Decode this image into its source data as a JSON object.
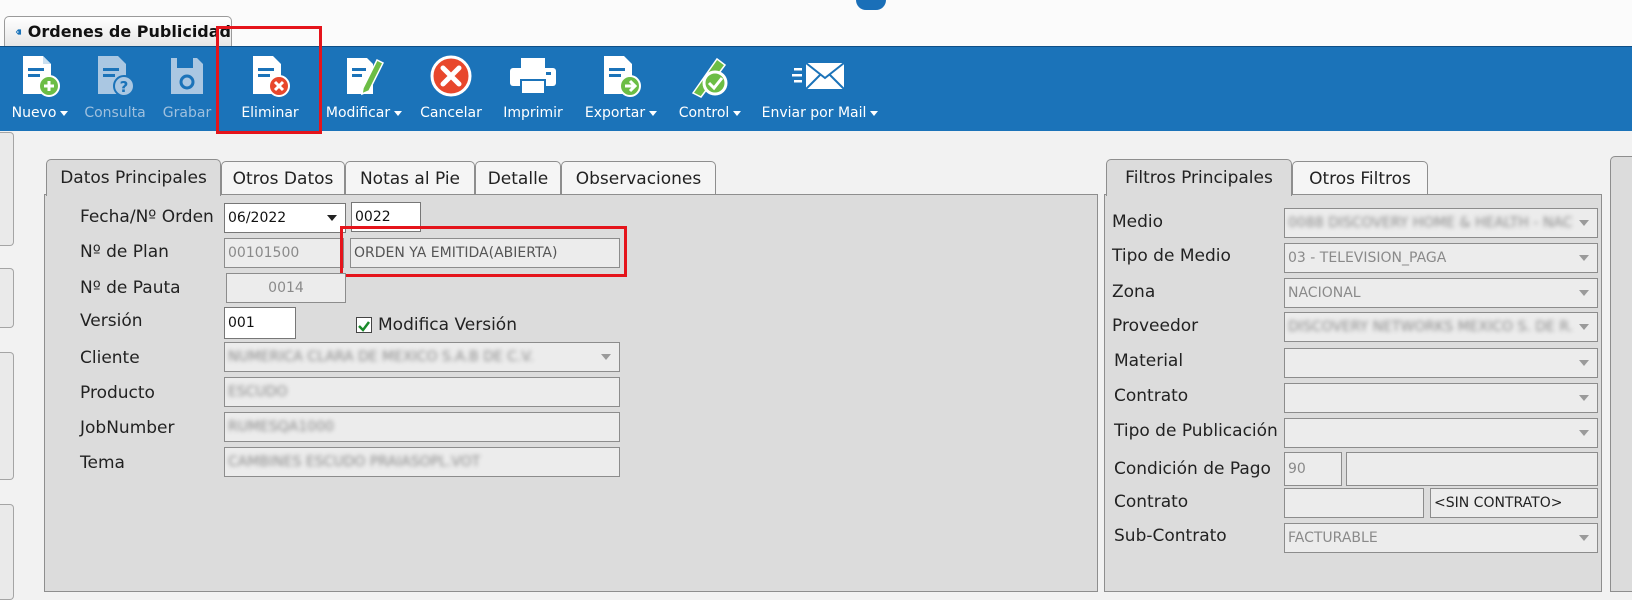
{
  "window": {
    "tab_title": "Ordenes de Publicidad"
  },
  "toolbar": {
    "nuevo": "Nuevo",
    "consulta": "Consulta",
    "grabar": "Grabar",
    "eliminar": "Eliminar",
    "modificar": "Modificar",
    "cancelar": "Cancelar",
    "imprimir": "Imprimir",
    "exportar": "Exportar",
    "control": "Control",
    "enviar_mail": "Enviar por Mail"
  },
  "main_tabs": [
    "Datos Principales",
    "Otros Datos",
    "Notas al Pie",
    "Detalle",
    "Observaciones"
  ],
  "datos_principales": {
    "fecha_label": "Fecha/Nº Orden",
    "fecha_value": "06/2022",
    "orden_value": "0022",
    "plan_label": "Nº de Plan",
    "plan_value": "00101500",
    "estado_value": "ORDEN YA EMITIDA(ABIERTA)",
    "pauta_label": "Nº de Pauta",
    "pauta_value": "0014",
    "version_label": "Versión",
    "version_value": "001",
    "modifica_version_label": "Modifica Versión",
    "modifica_version_checked": true,
    "cliente_label": "Cliente",
    "cliente_value": "NUMERICA CLARA DE MEXICO S.A.B DE C.V.",
    "producto_label": "Producto",
    "producto_value": "ESCUDO",
    "jobnumber_label": "JobNumber",
    "jobnumber_value": "RUMESQA1000",
    "tema_label": "Tema",
    "tema_value": "CAMBINES ESCUDO PRAIASOPL.VOT"
  },
  "filter_tabs": [
    "Filtros Principales",
    "Otros Filtros"
  ],
  "filtros": {
    "medio_label": "Medio",
    "medio_value": "0088 DISCOVERY HOME & HEALTH - NAC",
    "tipo_medio_label": "Tipo de Medio",
    "tipo_medio_value": "03 - TELEVISION_PAGA",
    "zona_label": "Zona",
    "zona_value": "NACIONAL",
    "proveedor_label": "Proveedor",
    "proveedor_value": "DISCOVERY NETWORKS MEXICO S. DE R.",
    "material_label": "Material",
    "contrato_label": "Contrato",
    "tipo_publicacion_label": "Tipo de Publicación",
    "condicion_pago_label": "Condición de Pago",
    "condicion_pago_value": "90",
    "contrato2_label": "Contrato",
    "sin_contrato_value": "<SIN CONTRATO>",
    "subcontrato_label": "Sub-Contrato",
    "subcontrato_value": "FACTURABLE"
  },
  "colors": {
    "toolbar_bg": "#1b73b9",
    "highlight": "#e5141b"
  }
}
